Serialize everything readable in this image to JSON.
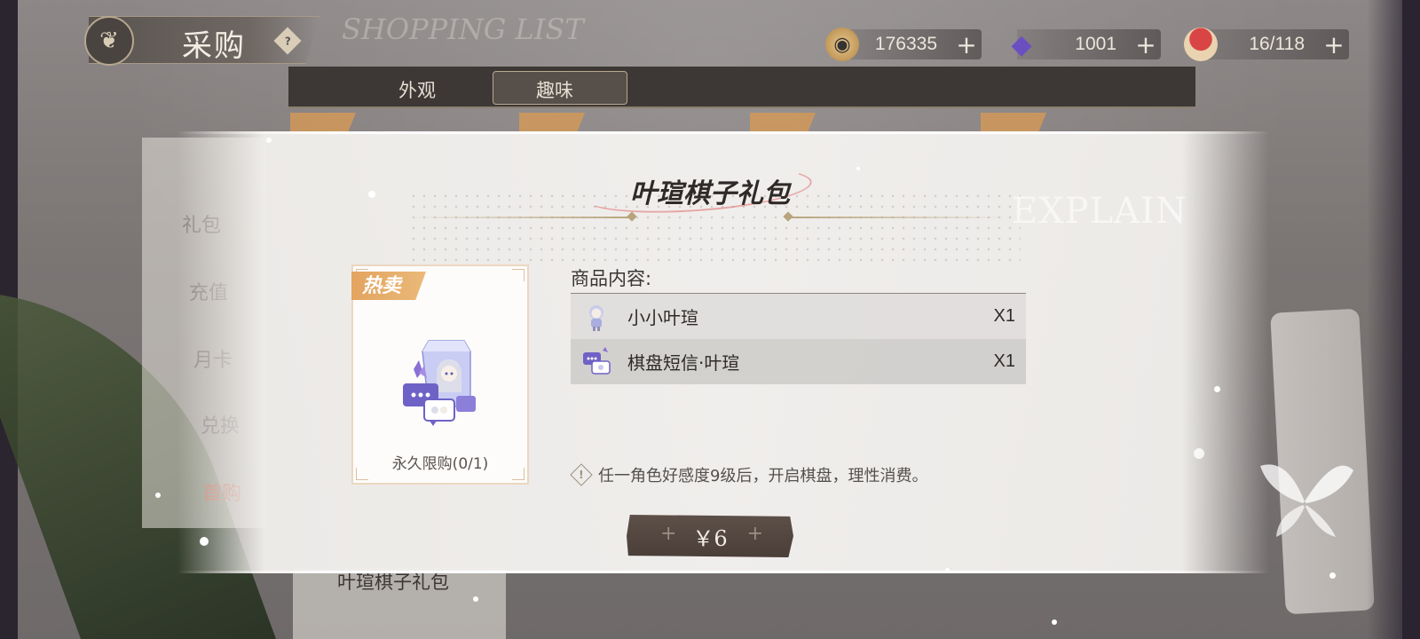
{
  "header": {
    "title": "采购",
    "subtitle": "SHOPPING LIST",
    "currencies": [
      {
        "icon": "gold-coin-icon",
        "value": "176335",
        "color": "#c9a163"
      },
      {
        "icon": "diamond-icon",
        "value": "1001",
        "color": "#6a4fc0"
      },
      {
        "icon": "cake-icon",
        "value": "16/118",
        "color": "#c23a3a"
      }
    ],
    "plus_label": "+"
  },
  "tabs": [
    {
      "label": "外观",
      "active": false
    },
    {
      "label": "趣味",
      "active": true
    }
  ],
  "background": {
    "side_menu": [
      "礼包",
      "充值",
      "月卡",
      "兑换",
      "首购"
    ],
    "card_tag": "热卖",
    "explain": "EXPLAIN",
    "bottom_card_title": "叶瑄棋子礼包"
  },
  "modal": {
    "title": "叶瑄棋子礼包",
    "product": {
      "badge": "热卖",
      "limit": "永久限购(0/1)"
    },
    "contents_label": "商品内容:",
    "items": [
      {
        "name": "小小叶瑄",
        "qty": "X1",
        "icon": "chibi-figure-icon"
      },
      {
        "name": "棋盘短信·叶瑄",
        "qty": "X1",
        "icon": "chat-bubble-icon"
      }
    ],
    "notice": "任一角色好感度9级后，开启棋盘，理性消费。",
    "buy_button": {
      "label": "￥6",
      "plus": "+"
    }
  }
}
